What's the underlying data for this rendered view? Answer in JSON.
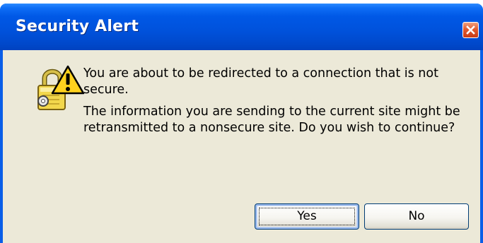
{
  "dialog": {
    "title": "Security Alert",
    "close_icon": "close-icon",
    "alert_icon": "lock-warning-icon",
    "message_line1": "You are about to be redirected to a connection that is not secure.",
    "message_line2": "The information you are sending to the current site might be retransmitted to a nonsecure site. Do you wish to continue?",
    "buttons": {
      "yes_label": "Yes",
      "no_label": "No"
    }
  }
}
